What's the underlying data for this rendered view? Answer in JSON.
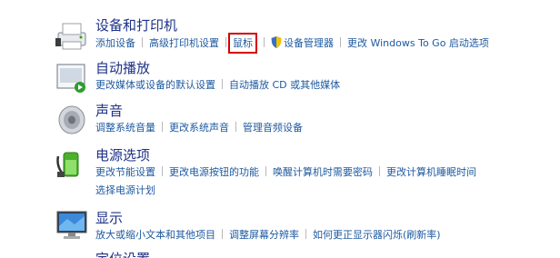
{
  "devices": {
    "title": "设备和打印机",
    "links": [
      "添加设备",
      "高级打印机设置",
      "鼠标",
      "设备管理器",
      "更改 Windows To Go 启动选项"
    ]
  },
  "autoplay": {
    "title": "自动播放",
    "links": [
      "更改媒体或设备的默认设置",
      "自动播放 CD 或其他媒体"
    ]
  },
  "sound": {
    "title": "声音",
    "links": [
      "调整系统音量",
      "更改系统声音",
      "管理音频设备"
    ]
  },
  "power": {
    "title": "电源选项",
    "links": [
      "更改节能设置",
      "更改电源按钮的功能",
      "唤醒计算机时需要密码",
      "更改计算机睡眠时间",
      "选择电源计划"
    ]
  },
  "display": {
    "title": "显示",
    "links": [
      "放大或缩小文本和其他项目",
      "调整屏幕分辨率",
      "如何更正显示器闪烁(刷新率)"
    ]
  },
  "next": {
    "title": "定位设置"
  },
  "colors": {
    "highlight": "#d40000",
    "title": "#1e3287",
    "link": "#1e5aa0"
  },
  "icons": [
    "printer-icon",
    "autoplay-icon",
    "speaker-icon",
    "power-options-icon",
    "monitor-icon",
    "shield-icon"
  ]
}
